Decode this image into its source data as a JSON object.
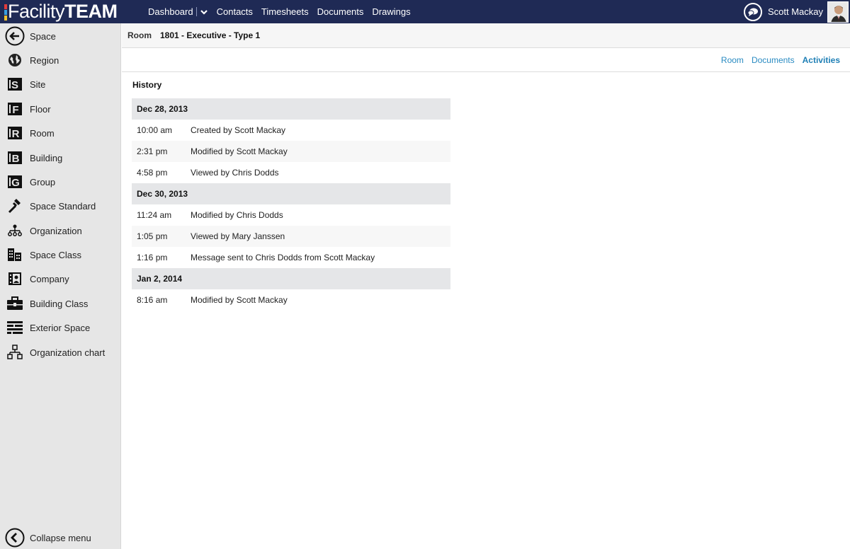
{
  "app": {
    "logo_light": "Facility",
    "logo_bold": "TEAM",
    "logo_colors": [
      "#e23b3b",
      "#3aa0e0",
      "#f2c230"
    ]
  },
  "topnav": {
    "items": [
      {
        "label": "Dashboard",
        "has_dropdown": true
      },
      {
        "label": "Contacts"
      },
      {
        "label": "Timesheets"
      },
      {
        "label": "Documents"
      },
      {
        "label": "Drawings"
      }
    ]
  },
  "user": {
    "name": "Scott Mackay",
    "chat_icon": "chat-bubble-icon",
    "avatar_icon": "user-avatar"
  },
  "sidebar": {
    "items": [
      {
        "label": "Space",
        "icon": "back-arrow-icon"
      },
      {
        "label": "Region",
        "icon": "globe-icon"
      },
      {
        "label": "Site",
        "icon": "site-icon"
      },
      {
        "label": "Floor",
        "icon": "floor-icon"
      },
      {
        "label": "Room",
        "icon": "room-icon"
      },
      {
        "label": "Building",
        "icon": "building-icon"
      },
      {
        "label": "Group",
        "icon": "group-icon"
      },
      {
        "label": "Space Standard",
        "icon": "hammer-icon"
      },
      {
        "label": "Organization",
        "icon": "org-tree-icon"
      },
      {
        "label": "Space Class",
        "icon": "buildings-icon"
      },
      {
        "label": "Company",
        "icon": "company-icon"
      },
      {
        "label": "Building Class",
        "icon": "briefcase-icon"
      },
      {
        "label": "Exterior Space",
        "icon": "wall-icon"
      },
      {
        "label": "Organization chart",
        "icon": "org-chart-icon"
      }
    ],
    "collapse_label": "Collapse menu"
  },
  "crumb": {
    "type": "Room",
    "name": "1801 - Executive - Type 1"
  },
  "tabs": [
    {
      "label": "Room",
      "active": false
    },
    {
      "label": "Documents",
      "active": false
    },
    {
      "label": "Activities",
      "active": true
    }
  ],
  "history": {
    "title": "History",
    "groups": [
      {
        "date": "Dec 28, 2013",
        "entries": [
          {
            "time": "10:00 am",
            "text": "Created by Scott Mackay"
          },
          {
            "time": "2:31 pm",
            "text": "Modified by Scott Mackay"
          },
          {
            "time": "4:58 pm",
            "text": "Viewed by Chris Dodds"
          }
        ]
      },
      {
        "date": "Dec 30, 2013",
        "entries": [
          {
            "time": "11:24 am",
            "text": "Modified by Chris Dodds"
          },
          {
            "time": "1:05 pm",
            "text": "Viewed by Mary Janssen"
          },
          {
            "time": "1:16 pm",
            "text": "Message sent to Chris Dodds from Scott Mackay"
          }
        ]
      },
      {
        "date": "Jan 2, 2014",
        "entries": [
          {
            "time": "8:16 am",
            "text": "Modified by Scott Mackay"
          }
        ]
      }
    ]
  }
}
